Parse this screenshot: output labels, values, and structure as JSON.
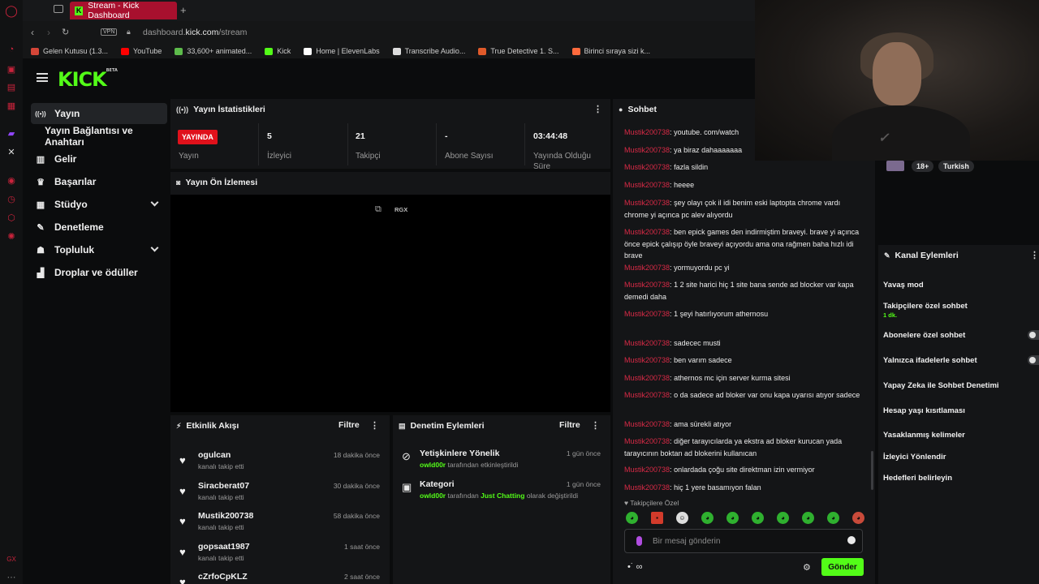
{
  "browser": {
    "tab_title": "Stream - Kick Dashboard",
    "url_prefix": "dashboard.",
    "url_domain": "kick.com",
    "url_path": "/stream",
    "vpn_label": "VPN",
    "bookmarks": [
      {
        "label": "Gelen Kutusu (1.3...",
        "color": "#d44638"
      },
      {
        "label": "YouTube",
        "color": "#ff0000"
      },
      {
        "label": "33,600+ animated...",
        "color": "#5dbb4b"
      },
      {
        "label": "Kick",
        "color": "#53fc18"
      },
      {
        "label": "Home | ElevenLabs",
        "color": "#ffffff"
      },
      {
        "label": "Transcribe Audio...",
        "color": "#dddddd"
      },
      {
        "label": "True Detective 1. S...",
        "color": "#e05a2a"
      },
      {
        "label": "Birinci sıraya sizi k...",
        "color": "#ff6a3d"
      }
    ]
  },
  "header": {
    "logo": "KICK",
    "logo_sup": "BETA"
  },
  "sidebar": {
    "items": [
      {
        "label": "Yayın",
        "icon": "broadcast-icon",
        "active": true,
        "chevron": false
      },
      {
        "label": "Yayın Bağlantısı ve Anahtarı",
        "icon": "",
        "active": false,
        "chevron": false
      },
      {
        "label": "Gelir",
        "icon": "chart-icon",
        "active": false,
        "chevron": false
      },
      {
        "label": "Başarılar",
        "icon": "trophy-icon",
        "active": false,
        "chevron": false
      },
      {
        "label": "Stüdyo",
        "icon": "studio-icon",
        "active": false,
        "chevron": true
      },
      {
        "label": "Denetleme",
        "icon": "wrench-icon",
        "active": false,
        "chevron": false
      },
      {
        "label": "Topluluk",
        "icon": "community-icon",
        "active": false,
        "chevron": true
      },
      {
        "label": "Droplar ve ödüller",
        "icon": "drops-icon",
        "active": false,
        "chevron": false
      }
    ]
  },
  "stats": {
    "title": "Yayın İstatistikleri",
    "live_badge": "YAYINDA",
    "items": [
      {
        "value": "",
        "label": "Yayın"
      },
      {
        "value": "5",
        "label": "İzleyici"
      },
      {
        "value": "21",
        "label": "Takipçi"
      },
      {
        "value": "-",
        "label": "Abone Sayısı"
      },
      {
        "value": "03:44:48",
        "label": "Yayında Olduğu Süre"
      }
    ]
  },
  "preview": {
    "title": "Yayın Ön İzlemesi",
    "label": "RGX"
  },
  "activity": {
    "title": "Etkinlik Akışı",
    "filter": "Filtre",
    "items": [
      {
        "name": "ogulcan",
        "sub": "kanalı takip etti",
        "time": "18 dakika önce"
      },
      {
        "name": "Siracberat07",
        "sub": "kanalı takip etti",
        "time": "30 dakika önce"
      },
      {
        "name": "Mustik200738",
        "sub": "kanalı takip etti",
        "time": "58 dakika önce"
      },
      {
        "name": "gopsaat1987",
        "sub": "kanalı takip etti",
        "time": "1 saat önce"
      },
      {
        "name": "cZrfoCpKLZ",
        "sub": "",
        "time": "2 saat önce"
      }
    ]
  },
  "moderation": {
    "title": "Denetim Eylemleri",
    "filter": "Filtre",
    "items": [
      {
        "title": "Yetişkinlere Yönelik",
        "user": "owld00r",
        "text1": " tarafından etkinleştirildi",
        "highlight": "",
        "text2": "",
        "time": "1 gün önce"
      },
      {
        "title": "Kategori",
        "user": "owld00r",
        "text1": " tarafından ",
        "highlight": "Just Chatting",
        "text2": " olarak değiştirildi",
        "time": "1 gün önce"
      }
    ]
  },
  "chat": {
    "title": "Sohbet",
    "messages": [
      {
        "user": "Mustik200738",
        "text": "youtube. com/watch"
      },
      {
        "user": "Mustik200738",
        "text": "ya biraz dahaaaaaaa"
      },
      {
        "user": "Mustik200738",
        "text": "fazla sildin"
      },
      {
        "user": "Mustik200738",
        "text": "heeee"
      },
      {
        "user": "Mustik200738",
        "text": "şey olayı çok il idi benim eski laptopta chrome vardı chrome yi açınca pc alev alıyordu"
      },
      {
        "user": "Mustik200738",
        "text": "ben epick games den indirmiştim braveyi. brave yi açınca önce epick çalışıp öyle braveyi açıyordu ama ona rağmen baha hızlı idi brave"
      },
      {
        "user": "Mustik200738",
        "text": "yormuyordu pc yi"
      },
      {
        "user": "Mustik200738",
        "text": "1 2 site harici hiç 1 site bana sende ad blocker var kapa demedi daha"
      },
      {
        "user": "Mustik200738",
        "text": "1 şeyi hatırlıyorum athernosu"
      },
      {
        "user": "Mustik200738",
        "text": "sadecec musti"
      },
      {
        "user": "Mustik200738",
        "text": "ben varım sadece"
      },
      {
        "user": "Mustik200738",
        "text": "athernos mc için server kurma sitesi"
      },
      {
        "user": "Mustik200738",
        "text": "o da sadece ad bloker var onu kapa uyarısı atıyor sadece"
      },
      {
        "user": "Mustik200738",
        "text": "ama sürekli atıyor"
      },
      {
        "user": "Mustik200738",
        "text": "diğer tarayıcılarda ya ekstra ad bloker kurucan yada tarayıcının boktan ad blokerini kullanıcan"
      },
      {
        "user": "Mustik200738",
        "text": "onlardada çoğu site direktman izin vermiyor"
      },
      {
        "user": "Mustik200738",
        "text": "hiç 1 yere basamıyon falan"
      }
    ],
    "followers_only": "Takipçilere Özel",
    "placeholder": "Bir mesaj gönderin",
    "send": "Gönder"
  },
  "channel": {
    "tags": [
      "18+",
      "Turkish"
    ]
  },
  "actions": {
    "title": "Kanal Eylemleri",
    "items": [
      {
        "label": "Yavaş mod",
        "sub": "",
        "toggle": false
      },
      {
        "label": "Takipçilere özel sohbet",
        "sub": "1 dk.",
        "toggle": false
      },
      {
        "label": "Abonelere özel sohbet",
        "sub": "",
        "toggle": true
      },
      {
        "label": "Yalnızca ifadelerle sohbet",
        "sub": "",
        "toggle": true
      },
      {
        "label": "Yapay Zeka ile Sohbet Denetimi",
        "sub": "",
        "toggle": false
      },
      {
        "label": "Hesap yaşı kısıtlaması",
        "sub": "",
        "toggle": false
      },
      {
        "label": "Yasaklanmış kelimeler",
        "sub": "",
        "toggle": false
      },
      {
        "label": "İzleyici Yönlendir",
        "sub": "",
        "toggle": false
      },
      {
        "label": "Hedefleri belirleyin",
        "sub": "",
        "toggle": false
      }
    ]
  },
  "colors": {
    "brand": "#53fc18",
    "live": "#e0111b",
    "chat_user": "#d82a46"
  }
}
